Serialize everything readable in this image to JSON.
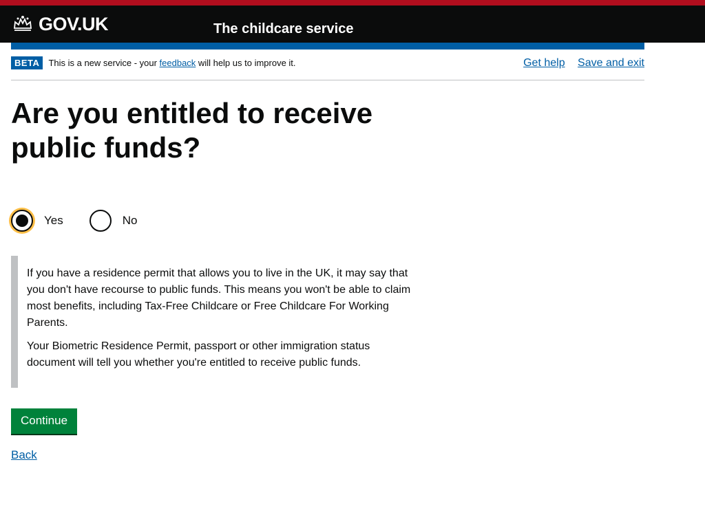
{
  "header": {
    "logo_text": "GOV.UK",
    "service_name": "The childcare service"
  },
  "phase_banner": {
    "tag": "BETA",
    "text_before": "This is a new service - your ",
    "feedback_link": "feedback",
    "text_after": " will help us to improve it.",
    "get_help": "Get help",
    "save_and_exit": "Save and exit"
  },
  "question": {
    "title": "Are you entitled to receive public funds?"
  },
  "radios": [
    {
      "label": "Yes",
      "checked": true
    },
    {
      "label": "No",
      "checked": false
    }
  ],
  "inset": {
    "paragraph1": "If you have a residence permit that allows you to live in the UK, it may say that you don't have recourse to public funds. This means you won't be able to claim most benefits, including Tax-Free Childcare or Free Childcare For Working Parents.",
    "paragraph2": "Your Biometric Residence Permit, passport or other immigration status document will tell you whether you're entitled to receive public funds."
  },
  "actions": {
    "continue_label": "Continue",
    "back_label": "Back"
  },
  "icons": {
    "logo_icon": "crown-icon"
  },
  "colors": {
    "header_bg": "#0b0c0c",
    "top_stripe": "#b10e1e",
    "brand_blue": "#005ea5",
    "button_green": "#00823b",
    "focus_yellow": "#ffbf47"
  }
}
